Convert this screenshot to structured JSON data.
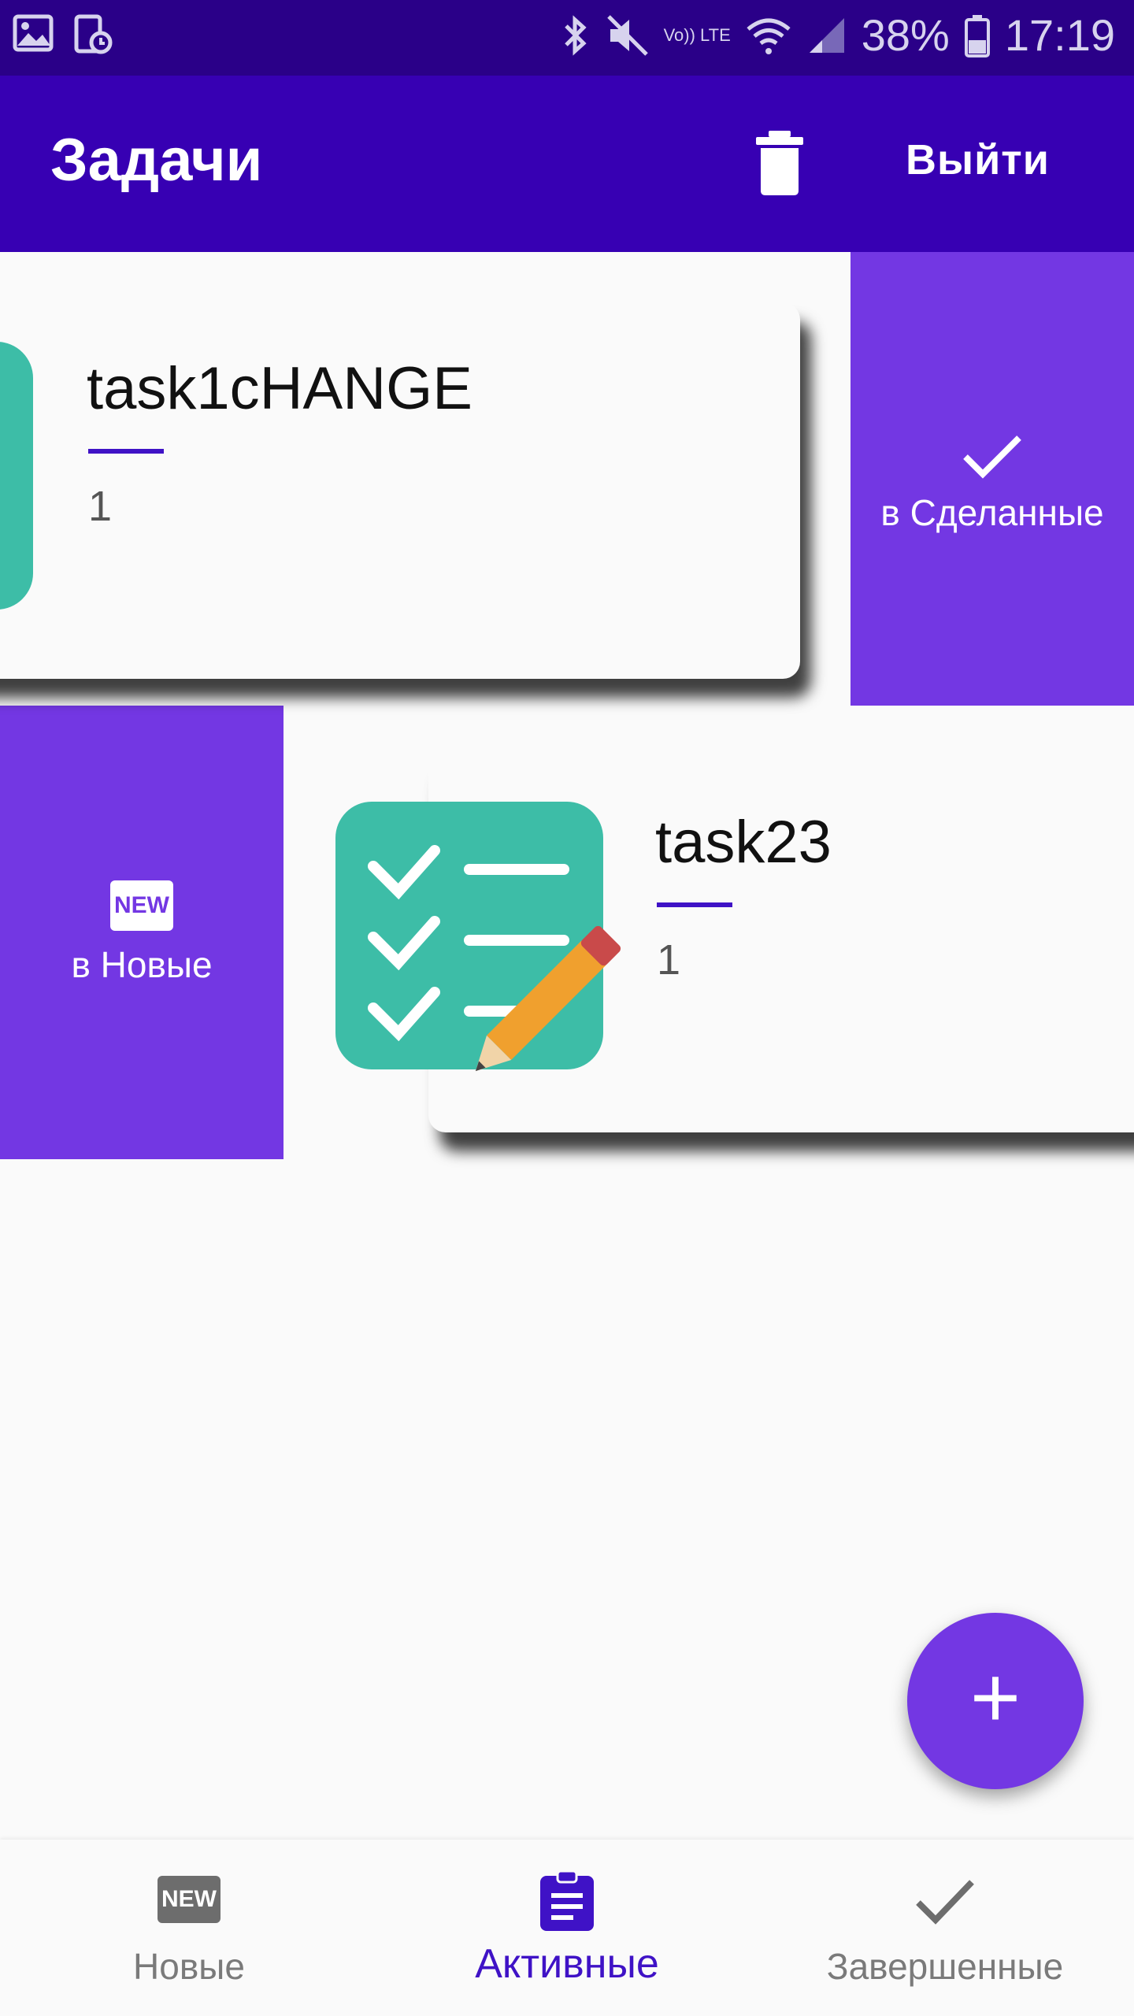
{
  "status_bar": {
    "volte": "Vo)) LTE",
    "battery": "38%",
    "time": "17:19"
  },
  "app_bar": {
    "title": "Задачи",
    "trash_icon": "trash-icon",
    "logout_label": "Выйти"
  },
  "swipe_actions": {
    "to_done": {
      "icon": "check-icon",
      "label": "в Сделанные"
    },
    "to_new": {
      "icon": "new-badge-icon",
      "badge": "NEW",
      "label": "в Новые"
    }
  },
  "tasks": [
    {
      "title": "task1cHANGE",
      "description": "1",
      "icon": "checklist-pencil-icon"
    },
    {
      "title": "task23",
      "description": "1",
      "icon": "checklist-pencil-icon"
    }
  ],
  "fab": {
    "label": "+"
  },
  "bottom_nav": {
    "items": [
      {
        "label": "Новые",
        "icon": "new-badge-icon",
        "badge": "NEW",
        "active": false
      },
      {
        "label": "Активные",
        "icon": "clipboard-icon",
        "active": true
      },
      {
        "label": "Завершенные",
        "icon": "check-icon",
        "active": false
      }
    ]
  },
  "colors": {
    "status_bar": "#2a0088",
    "app_bar": "#3700b3",
    "accent": "#7337e3",
    "active_nav": "#3f12c6",
    "task_icon_bg": "#3dbda7"
  }
}
